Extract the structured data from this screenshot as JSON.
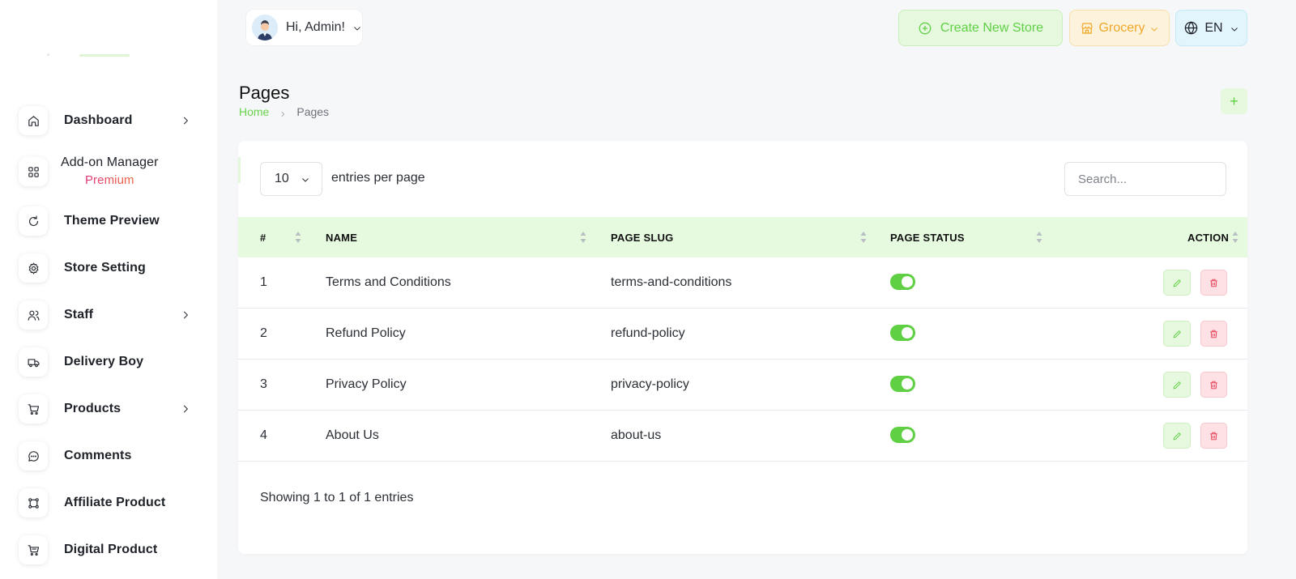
{
  "header": {
    "greeting": "Hi, Admin!",
    "create_store_label": "Create New Store",
    "store_type_label": "Grocery",
    "language_label": "EN"
  },
  "sidebar": {
    "items": [
      {
        "label": "Dashboard",
        "icon": "home-icon",
        "has_children": true
      },
      {
        "label": "Add-on Manager",
        "badge": "Premium",
        "icon": "grid-icon",
        "has_children": false
      },
      {
        "label": "Theme Preview",
        "icon": "refresh-icon",
        "has_children": false
      },
      {
        "label": "Store Setting",
        "icon": "gear-icon",
        "has_children": false
      },
      {
        "label": "Staff",
        "icon": "users-icon",
        "has_children": true
      },
      {
        "label": "Delivery Boy",
        "icon": "truck-icon",
        "has_children": false
      },
      {
        "label": "Products",
        "icon": "cart-icon",
        "has_children": true
      },
      {
        "label": "Comments",
        "icon": "chat-icon",
        "has_children": false
      },
      {
        "label": "Affiliate Product",
        "icon": "affiliate-icon",
        "has_children": false
      },
      {
        "label": "Digital Product",
        "icon": "digital-cart-icon",
        "has_children": false
      }
    ]
  },
  "page": {
    "title": "Pages",
    "breadcrumb": {
      "home": "Home",
      "current": "Pages"
    },
    "add_button": "+"
  },
  "table": {
    "per_page_value": "10",
    "per_page_label": "entries per page",
    "search_placeholder": "Search...",
    "columns": [
      "#",
      "NAME",
      "PAGE SLUG",
      "PAGE STATUS",
      "ACTION"
    ],
    "rows": [
      {
        "num": "1",
        "name": "Terms and Conditions",
        "slug": "terms-and-conditions",
        "status": true
      },
      {
        "num": "2",
        "name": "Refund Policy",
        "slug": "refund-policy",
        "status": true
      },
      {
        "num": "3",
        "name": "Privacy Policy",
        "slug": "privacy-policy",
        "status": true
      },
      {
        "num": "4",
        "name": "About Us",
        "slug": "about-us",
        "status": true
      }
    ],
    "footer": "Showing 1 to 1 of 1 entries"
  },
  "colors": {
    "accent_green": "#5fd043",
    "header_row_bg": "#e6fadf",
    "warning_orange": "#f0a727",
    "danger_red": "#e8384f",
    "premium_pink": "#e0357c"
  }
}
